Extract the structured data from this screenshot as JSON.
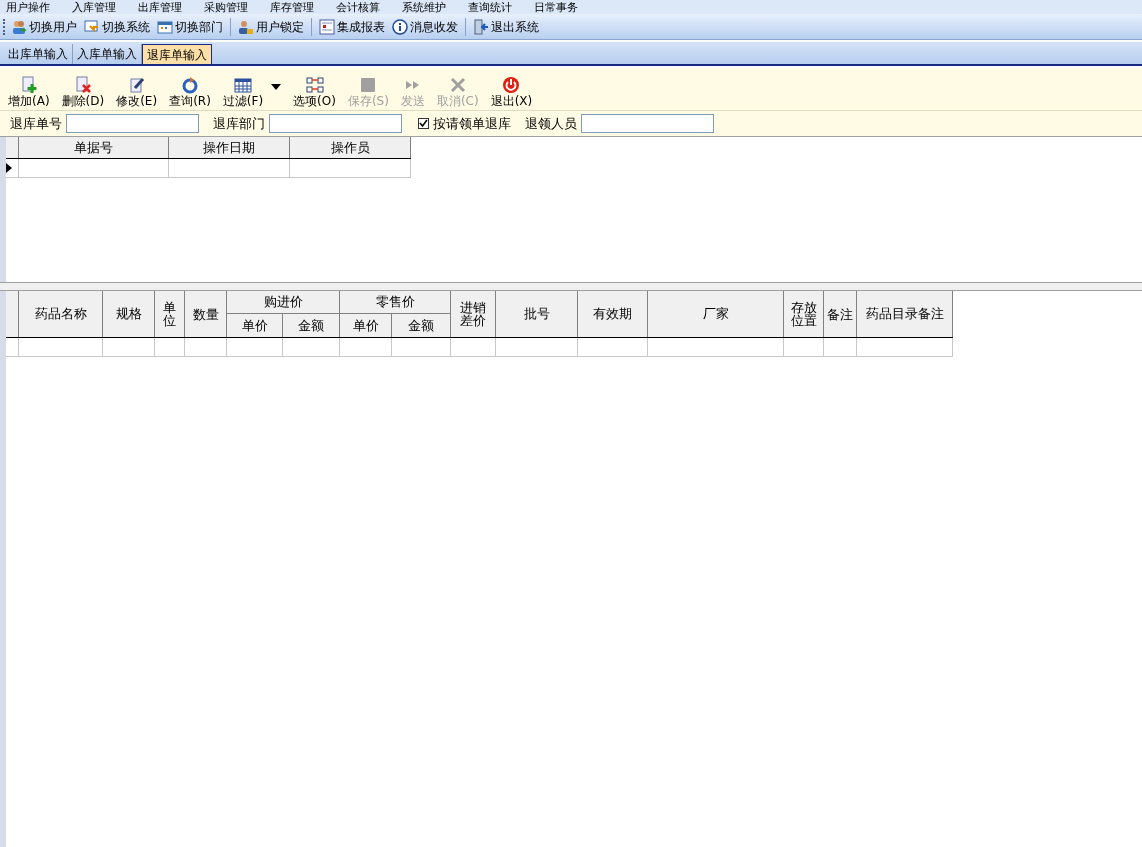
{
  "menu": [
    "用户操作",
    "入库管理",
    "出库管理",
    "采购管理",
    "库存管理",
    "会计核算",
    "系统维护",
    "查询统计",
    "日常事务"
  ],
  "quick_toolbar": [
    [
      {
        "label": "切换用户"
      },
      {
        "label": "切换系统"
      },
      {
        "label": "切换部门"
      }
    ],
    [
      {
        "label": "用户锁定"
      }
    ],
    [
      {
        "label": "集成报表"
      },
      {
        "label": "消息收发"
      }
    ],
    [
      {
        "label": "退出系统"
      }
    ]
  ],
  "tabs": [
    {
      "label": "出库单输入",
      "selected": false
    },
    {
      "label": "入库单输入",
      "selected": false
    },
    {
      "label": "退库单输入",
      "selected": true
    }
  ],
  "actions": [
    {
      "label": "增加(A)",
      "disabled": false,
      "kind": "button"
    },
    {
      "label": "删除(D)",
      "disabled": false,
      "kind": "button"
    },
    {
      "label": "修改(E)",
      "disabled": false,
      "kind": "button"
    },
    {
      "label": "查询(R)",
      "disabled": false,
      "kind": "button"
    },
    {
      "label": "过滤(F)",
      "disabled": false,
      "kind": "dropdown"
    },
    {
      "label": "选项(O)",
      "disabled": false,
      "kind": "button"
    },
    {
      "label": "保存(S)",
      "disabled": true,
      "kind": "button"
    },
    {
      "label": "发送",
      "disabled": true,
      "kind": "button"
    },
    {
      "label": "取消(C)",
      "disabled": true,
      "kind": "button"
    },
    {
      "label": "退出(X)",
      "disabled": false,
      "kind": "button"
    }
  ],
  "filters": [
    {
      "kind": "field",
      "label": "退库单号"
    },
    {
      "kind": "field",
      "label": "退库部门"
    },
    {
      "kind": "checkbox",
      "label": "按请领单退库",
      "checked": true
    },
    {
      "kind": "field",
      "label": "退领人员"
    }
  ],
  "orders_table": {
    "columns": [
      "单据号",
      "操作日期",
      "操作员"
    ],
    "rows": [
      {
        "selected": true
      }
    ]
  },
  "items_table": {
    "columns": [
      {
        "label": "药品名称"
      },
      {
        "label": "规格"
      },
      {
        "label": "单位"
      },
      {
        "label": "数量"
      },
      {
        "label": "购进价",
        "children": [
          "单价",
          "金额"
        ]
      },
      {
        "label": "零售价",
        "children": [
          "单价",
          "金额"
        ]
      },
      {
        "label": "进销差价"
      },
      {
        "label": "批号"
      },
      {
        "label": "有效期"
      },
      {
        "label": "厂家"
      },
      {
        "label": "存放位置"
      },
      {
        "label": "备注"
      },
      {
        "label": "药品目录备注"
      }
    ],
    "rows": [
      {
        "selected": false
      }
    ]
  }
}
